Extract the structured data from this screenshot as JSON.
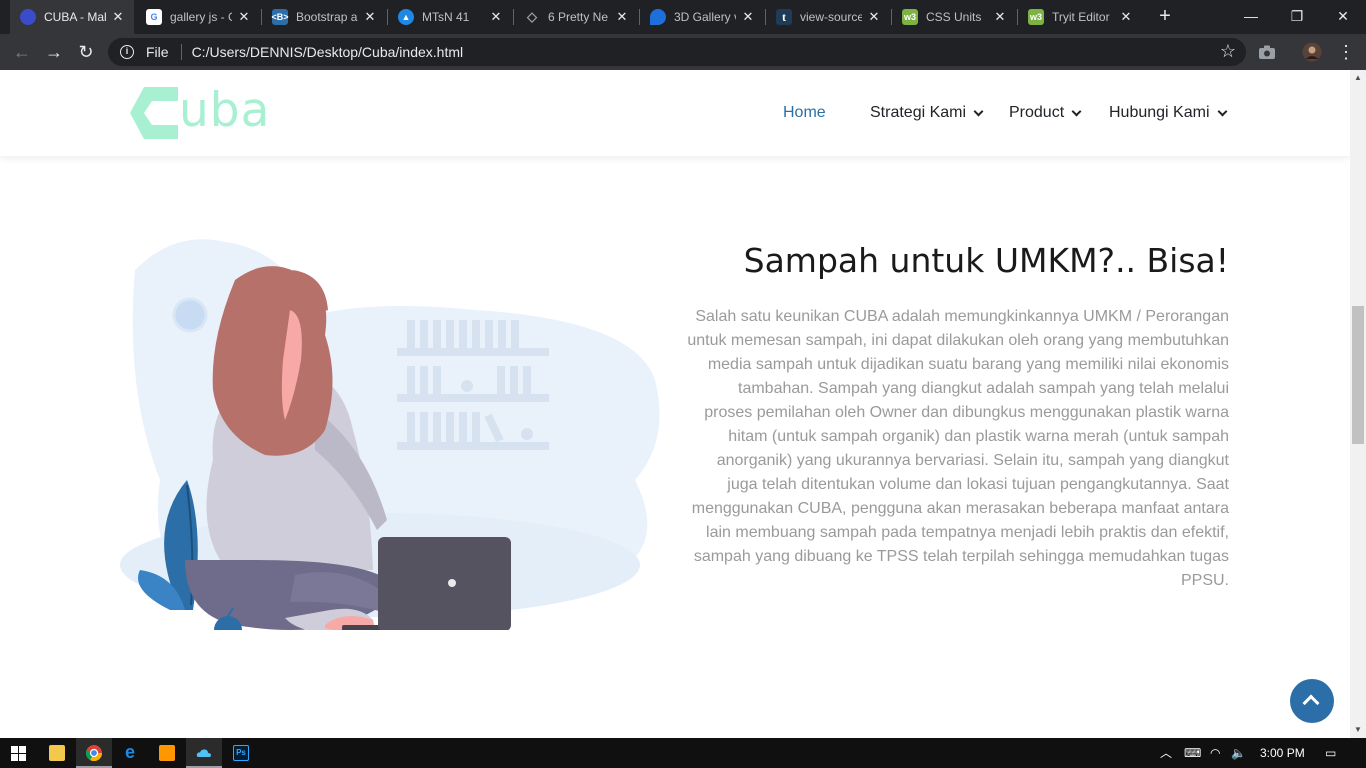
{
  "browser": {
    "tabs": [
      {
        "title": "CUBA - Mal",
        "favicon": "cuba-favicon",
        "color": "#3b4cca",
        "active": true
      },
      {
        "title": "gallery js - G",
        "favicon": "google-favicon",
        "color": "#ffffff",
        "active": false
      },
      {
        "title": "Bootstrap a",
        "favicon": "bootstrap-favicon",
        "color": "#2b6ea8",
        "active": false
      },
      {
        "title": "MTsN 41",
        "favicon": "school-favicon",
        "color": "#1e88e5",
        "active": false
      },
      {
        "title": "6 Pretty Ne",
        "favicon": "codepen-favicon",
        "color": "#9aa0a6",
        "active": false
      },
      {
        "title": "3D Gallery v",
        "favicon": "drop-favicon",
        "color": "#1e6fd9",
        "active": false
      },
      {
        "title": "view-source",
        "favicon": "t-favicon",
        "color": "#1f3b57",
        "active": false
      },
      {
        "title": "CSS Units",
        "favicon": "w3-favicon",
        "color": "#7cb342",
        "active": false
      },
      {
        "title": "Tryit Editor",
        "favicon": "w3-favicon",
        "color": "#7cb342",
        "active": false
      }
    ],
    "address": {
      "scheme_label": "File",
      "url": "C:/Users/DENNIS/Desktop/Cuba/index.html"
    }
  },
  "site": {
    "logo_text": "uba",
    "nav": [
      {
        "label": "Home",
        "active": true,
        "dropdown": false
      },
      {
        "label": "Strategi Kami",
        "active": false,
        "dropdown": true
      },
      {
        "label": "Product",
        "active": false,
        "dropdown": true
      },
      {
        "label": "Hubungi Kami",
        "active": false,
        "dropdown": true
      }
    ],
    "section": {
      "heading": "Sampah untuk UMKM?.. Bisa!",
      "paragraph": "Salah satu keunikan CUBA adalah memungkinkannya UMKM / Perorangan untuk memesan sampah, ini dapat dilakukan oleh orang yang membutuhkan media sampah untuk dijadikan suatu barang yang memiliki nilai ekonomis tambahan. Sampah yang diangkut adalah sampah yang telah melalui proses pemilahan oleh Owner dan dibungkus menggunakan plastik warna hitam (untuk sampah organik) dan plastik warna merah (untuk sampah anorganik) yang ukurannya bervariasi. Selain itu, sampah yang diangkut juga telah ditentukan volume dan lokasi tujuan pengangkutannya. Saat menggunakan CUBA, pengguna akan merasakan beberapa manfaat antara lain membuang sampah pada tempatnya menjadi lebih praktis dan efektif, sampah yang dibuang ke TPSS telah terpilah sehingga memudahkan tugas PPSU."
    },
    "colors": {
      "brand": "#a8f0d2",
      "nav_active": "#2b6ea8",
      "back_to_top": "#2b6ea8"
    }
  },
  "taskbar": {
    "time": "3:00 PM"
  }
}
